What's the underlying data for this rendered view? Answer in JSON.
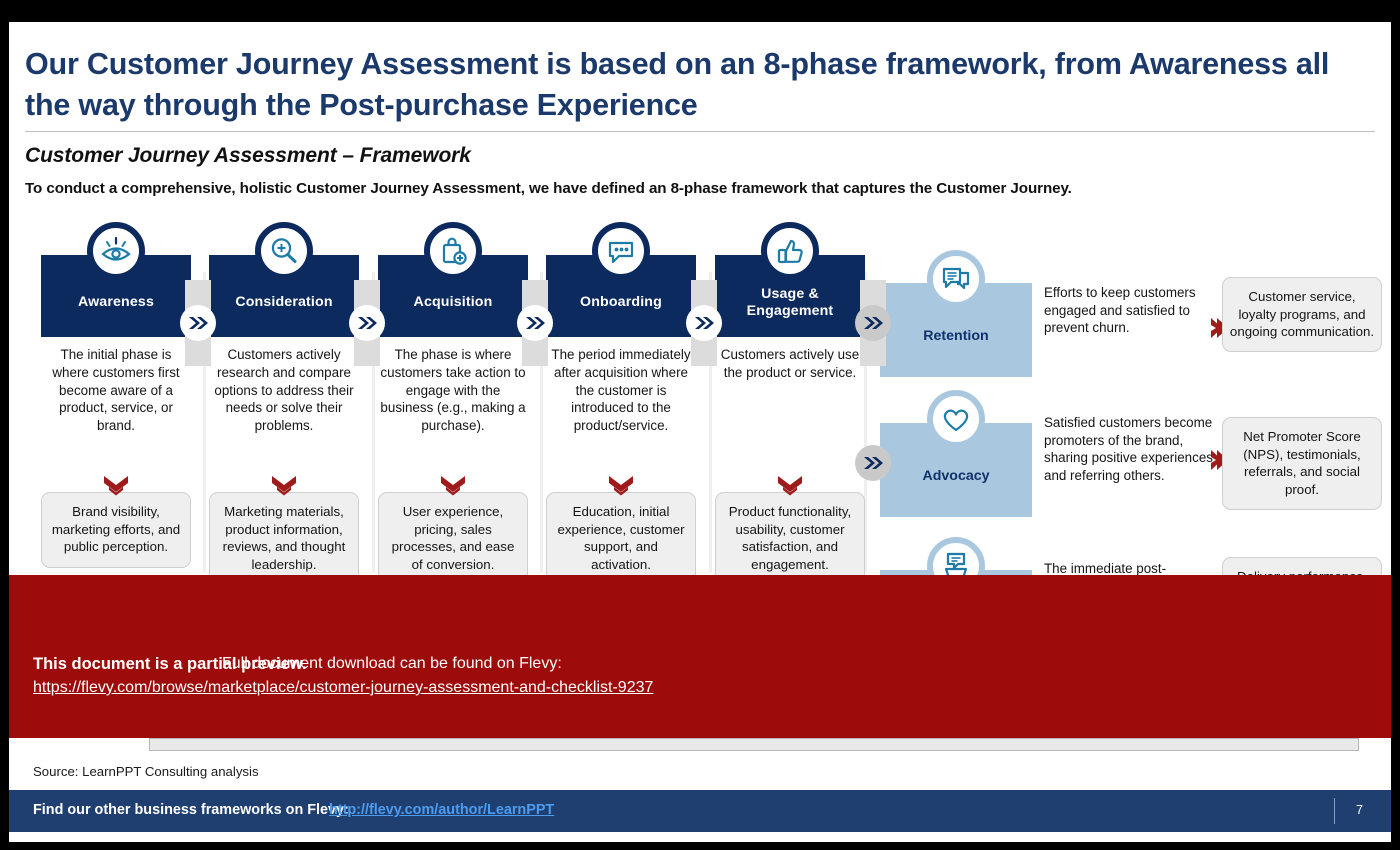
{
  "slide": {
    "title": "Our Customer Journey Assessment is based on an 8-phase framework, from Awareness all the way through the Post-purchase Experience",
    "subhead": "Customer Journey Assessment – Framework",
    "lead": "To conduct a comprehensive, holistic Customer Journey Assessment, we have defined an 8-phase framework that captures the Customer Journey.",
    "source": "Source: LearnPPT Consulting analysis",
    "page_number": "7"
  },
  "colors": {
    "title_blue": "#1b3a6b",
    "phase_navy": "#0d2a5e",
    "phase_light_blue": "#a9c8e0",
    "sub_box_grey": "#efefef",
    "red_chevron": "#9e1b1b",
    "preview_red": "#9e0b0b",
    "footer_navy": "#1f3f70",
    "footer_link_blue": "#4d9cf0",
    "icon_teal": "#1d7ba8"
  },
  "phases": [
    {
      "label": "Awareness",
      "icon": "eye-visibility-icon",
      "description": "The initial phase is where customers first become aware of a product, service, or brand.",
      "sub": "Brand visibility, marketing efforts, and public perception."
    },
    {
      "label": "Consideration",
      "icon": "magnifier-plus-icon",
      "description": "Customers actively research and compare options to address their needs or solve their problems.",
      "sub": "Marketing materials, product information, reviews, and thought leadership."
    },
    {
      "label": "Acquisition",
      "icon": "shopping-bag-plus-icon",
      "description": "The phase is where customers take action to engage with the business (e.g., making a purchase).",
      "sub": "User experience, pricing, sales processes, and ease of conversion."
    },
    {
      "label": "Onboarding",
      "icon": "chat-bubble-dots-icon",
      "description": "The period immediately after acquisition where the customer is introduced to the product/service.",
      "sub": "Education, initial experience, customer support, and activation."
    },
    {
      "label": "Usage & Engagement",
      "icon": "thumbs-up-icon",
      "description": "Customers actively use the product or service.",
      "sub": "Product functionality, usability, customer satisfaction, and engagement."
    }
  ],
  "right_phases": [
    {
      "label": "Retention",
      "icon": "chat-bubbles-lines-icon",
      "description": "Efforts to keep customers engaged and satisfied to prevent churn.",
      "sub": "Customer service, loyalty programs, and ongoing communication."
    },
    {
      "label": "Advocacy",
      "icon": "heart-icon",
      "description": "Satisfied customers become promoters of the brand, sharing positive experiences and referring others.",
      "sub": "Net Promoter Score (NPS), testimonials, referrals, and social proof."
    },
    {
      "label": "",
      "icon": "delivery-chat-icon",
      "description": "The immediate post-purchase period ensures",
      "sub": "Delivery performance,"
    }
  ],
  "preview": {
    "strong": "This document is a partial preview.",
    "rest": "Full document download can be found on Flevy:",
    "link": "https://flevy.com/browse/marketplace/customer-journey-assessment-and-checklist-9237"
  },
  "footer": {
    "text": "Find our other business frameworks on Flevy:",
    "link": "http://flevy.com/author/LearnPPT"
  }
}
